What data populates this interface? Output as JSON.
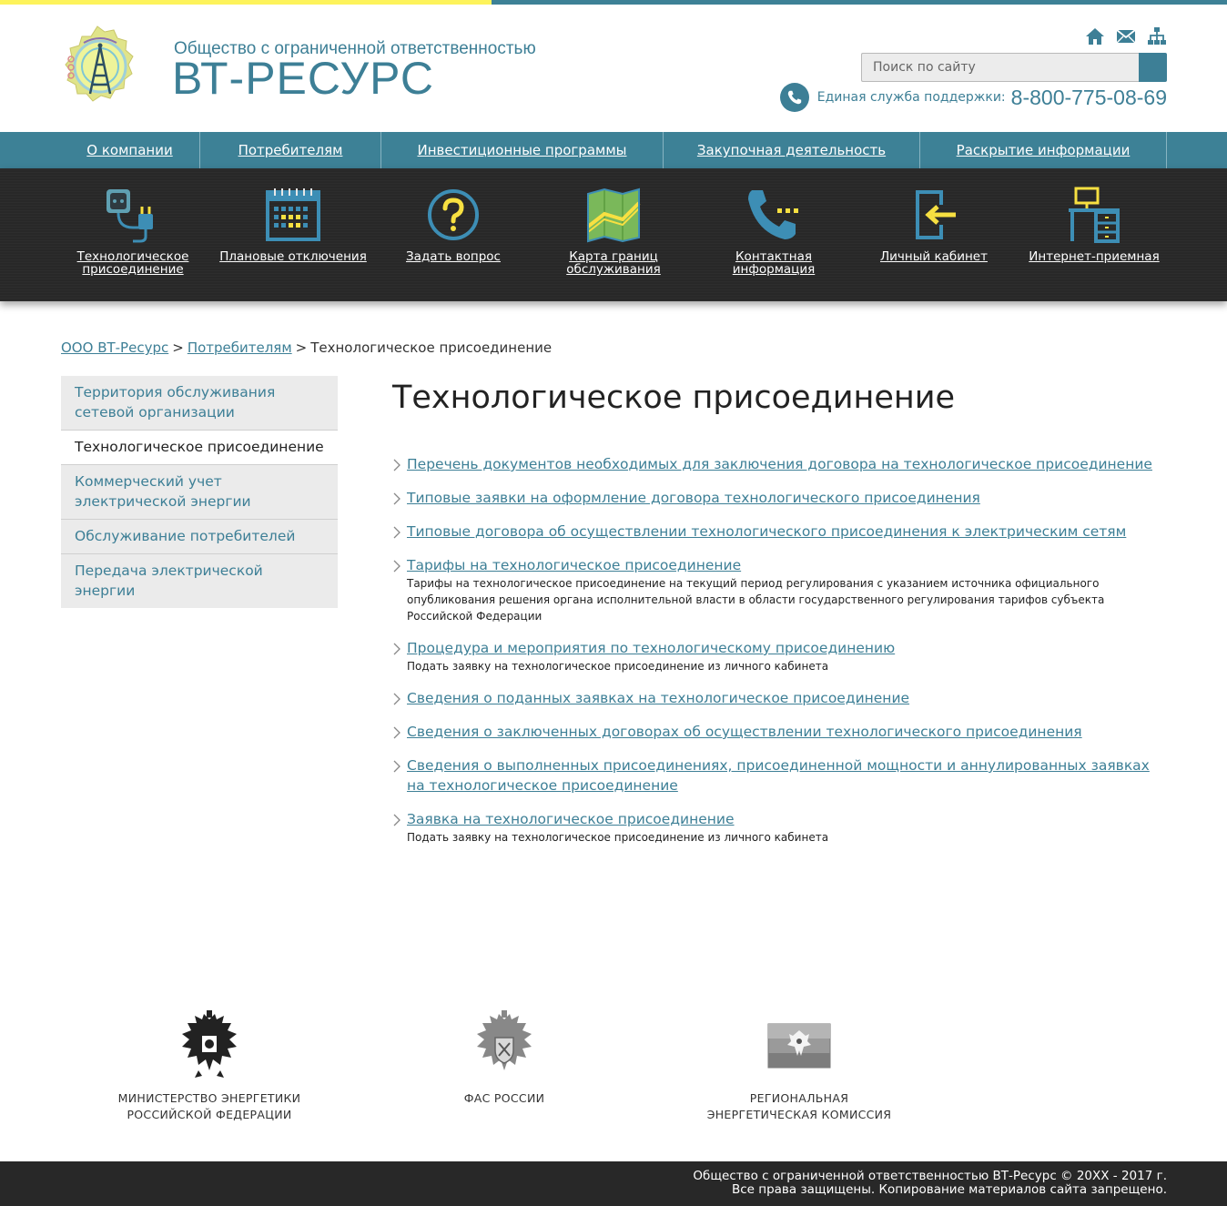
{
  "header": {
    "subtitle": "Общество с ограниченной ответственностью",
    "title": "ВТ-РЕСУРС",
    "search_placeholder": "Поиск по сайту",
    "support_label": "Единая служба поддержки:",
    "support_phone": "8-800-775-08-69"
  },
  "mainnav": [
    {
      "label": "О компании"
    },
    {
      "label": "Потребителям"
    },
    {
      "label": "Инвестиционные программы"
    },
    {
      "label": "Закупочная деятельность"
    },
    {
      "label": "Раскрытие информации"
    }
  ],
  "iconbar": [
    {
      "label": "Технологическое присоединение",
      "icon": "socket-plug-icon"
    },
    {
      "label": "Плановые отключения",
      "icon": "calendar-icon"
    },
    {
      "label": "Задать вопрос",
      "icon": "question-icon"
    },
    {
      "label": "Карта границ обслуживания",
      "icon": "map-icon"
    },
    {
      "label": "Контактная информация",
      "icon": "phone-icon"
    },
    {
      "label": "Личный кабинет",
      "icon": "login-icon"
    },
    {
      "label": "Интернет-приемная",
      "icon": "desk-icon"
    }
  ],
  "breadcrumb": {
    "items": [
      "ООО ВТ-Ресурс",
      "Потребителям"
    ],
    "separator": ">",
    "current": "Технологическое присоединение"
  },
  "sidebar": [
    {
      "label": "Территория обслуживания сетевой организации",
      "active": false
    },
    {
      "label": "Технологическое присоединение",
      "active": true
    },
    {
      "label": "Коммерческий учет электрической энергии",
      "active": false
    },
    {
      "label": "Обслуживание потребителей",
      "active": false
    },
    {
      "label": "Передача электрической энергии",
      "active": false
    }
  ],
  "content": {
    "title": "Технологическое присоединение",
    "items": [
      {
        "link": "Перечень документов необходимых для заключения договора на технологическое присоединение",
        "desc": ""
      },
      {
        "link": "Типовые заявки на оформление договора технологического присоединения",
        "desc": ""
      },
      {
        "link": "Типовые договора об осуществлении технологического присоединения к электрическим сетям",
        "desc": ""
      },
      {
        "link": "Тарифы на технологическое присоединение",
        "desc": "Тарифы на технологическое присоединение на текущий период регулирования с указанием источника официального опубликования решения органа исполнительной власти в области государственного регулирования тарифов субъекта Российской Федерации"
      },
      {
        "link": "Процедура и мероприятия по технологическому присоединению",
        "desc": "Подать заявку на технологическое присоединение из личного кабинета"
      },
      {
        "link": "Сведения о поданных заявках на технологическое присоединение",
        "desc": ""
      },
      {
        "link": "Сведения о заключенных договорах об осуществлении технологического присоединения",
        "desc": ""
      },
      {
        "link": "Сведения о выполненных присоединениях, присоединенной мощности и аннулированных заявках на технологическое присоединение",
        "desc": ""
      },
      {
        "link": "Заявка на технологическое присоединение",
        "desc": "Подать заявку на технологическое присоединение из личного кабинета"
      }
    ]
  },
  "footer_logos": [
    {
      "caption_line1": "МИНИСТЕРСТВО ЭНЕРГЕТИКИ",
      "caption_line2": "РОССИЙСКОЙ ФЕДЕРАЦИИ"
    },
    {
      "caption_line1": "ФАС РОССИИ",
      "caption_line2": ""
    },
    {
      "caption_line1": "РЕГИОНАЛЬНАЯ",
      "caption_line2": "ЭНЕРГЕТИЧЕСКАЯ КОМИССИЯ"
    }
  ],
  "footer": {
    "line1": "Общество с ограниченной ответственностью ВТ-Ресурс © 20XX - 2017 г.",
    "line2": "Все права защищены. Копирование материалов сайта запрещено."
  },
  "colors": {
    "accent": "#3d7f96",
    "dark": "#282828",
    "yellow": "#fdf35b"
  }
}
